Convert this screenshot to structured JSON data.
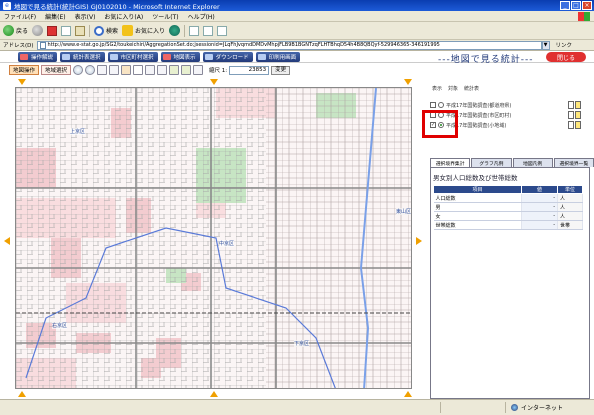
{
  "window": {
    "title": "地図で見る統計(統計GIS) GJ0102010 - Microsoft Internet Explorer",
    "buttons": [
      "_",
      "□",
      "×"
    ]
  },
  "menu": [
    "ファイル(F)",
    "編集(E)",
    "表示(V)",
    "お気に入り(A)",
    "ツール(T)",
    "ヘルプ(H)"
  ],
  "toolbar": {
    "back": "戻る",
    "search": "検索",
    "favorites": "お気に入り"
  },
  "address": {
    "label": "アドレス(D)",
    "url": "http://www.e-stat.go.jp/SG2/toukeichiri/AggregationSet.do;jsessionid=JLqFhJvqmdDMDvMhpjFLB9B1BGNTzqFLHTBhqD54h4B8QBQyf-529946365-346191995",
    "links": "リンク"
  },
  "app": {
    "nav": [
      "操作解説",
      "統計表選択",
      "市区町村選択",
      "地図表示",
      "ダウンロード",
      "印刷用画面"
    ],
    "title": "---地図で見る統計---",
    "close": "閉じる"
  },
  "maptools": {
    "tabs": [
      "地図操作",
      "地域選択"
    ],
    "scale_label": "縮尺 1:",
    "scale_value": "23853",
    "apply": "変更"
  },
  "map": {
    "labels": [
      "中京区",
      "下京区",
      "右京区",
      "東山区",
      "上京区"
    ]
  },
  "panel": {
    "headers": [
      "表示",
      "対象",
      "統計表"
    ],
    "layers": [
      {
        "label": "平成17年国勢調査(都道府県)",
        "checked": false,
        "radio": false
      },
      {
        "label": "平成17年国勢調査(市区町村)",
        "checked": false,
        "radio": false
      },
      {
        "label": "平成17年国勢調査(小地域)",
        "checked": true,
        "radio": true
      }
    ],
    "tabs": [
      "選択境界集計",
      "グラフ凡例",
      "地図凡例",
      "選択境界一覧"
    ],
    "stats_title": "男女別人口総数及び世帯総数",
    "table_headers": [
      "項目",
      "値",
      "単位"
    ],
    "rows": [
      {
        "item": "人口総数",
        "value": "-",
        "unit": "人"
      },
      {
        "item": "男",
        "value": "-",
        "unit": "人"
      },
      {
        "item": "女",
        "value": "-",
        "unit": "人"
      },
      {
        "item": "世帯総数",
        "value": "-",
        "unit": "世帯"
      }
    ]
  },
  "status": {
    "zone": "インターネット"
  },
  "colors": {
    "title_bar": "#1d5bd8",
    "highlight": "#e00000",
    "table_header": "#2c4a8c",
    "pan_arrow": "#f0a000"
  }
}
